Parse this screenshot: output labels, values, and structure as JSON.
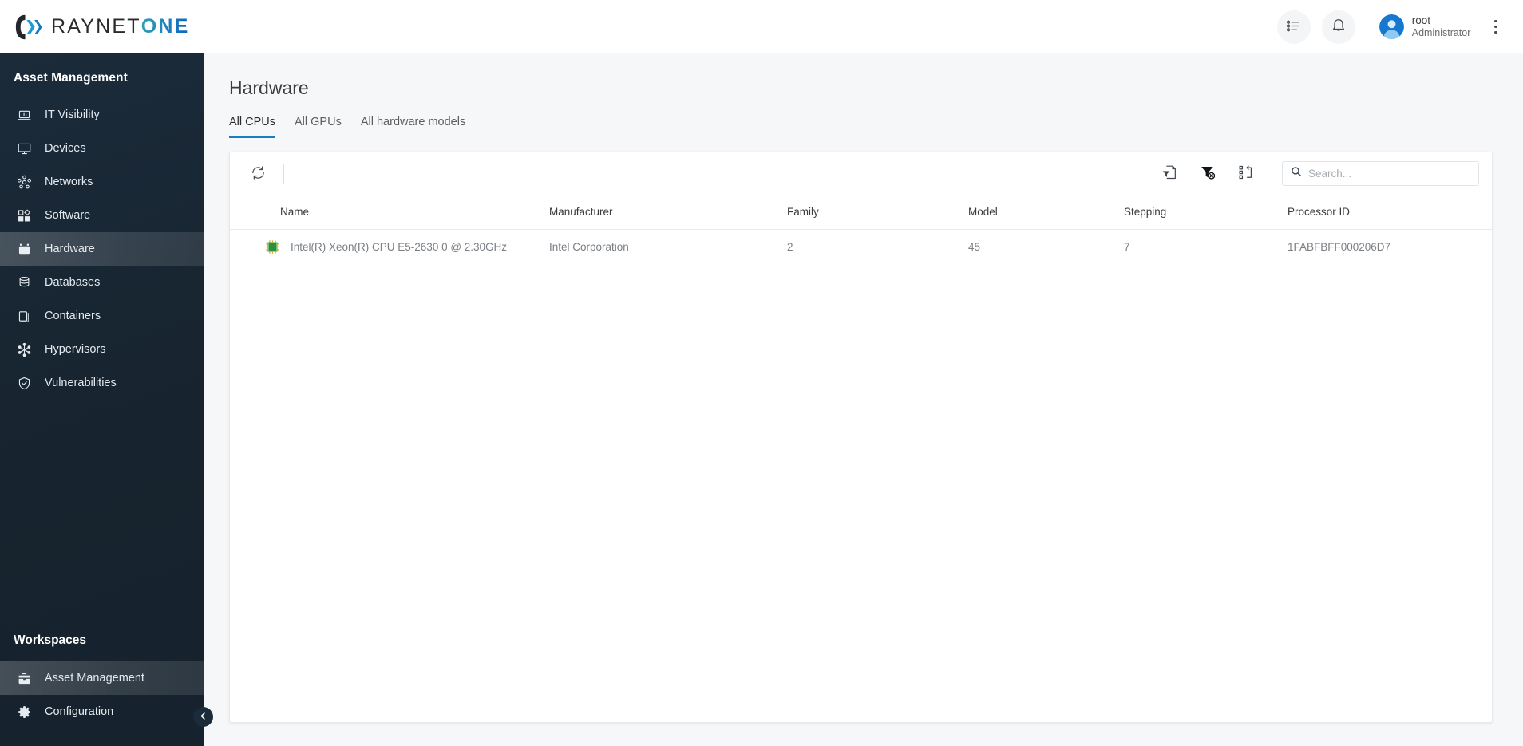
{
  "brand": {
    "name_dark": "RAYNET",
    "name_accent": "ONE",
    "logo_icon": "raynet-logo-mark"
  },
  "topbar": {
    "tasks_icon": "task-list-icon",
    "notifications_icon": "bell-icon",
    "user": {
      "name": "root",
      "role": "Administrator",
      "avatar_icon": "user-avatar-icon"
    },
    "more_icon": "kebab-menu-icon"
  },
  "sidebar": {
    "section_title": "Asset Management",
    "items": [
      {
        "label": "IT Visibility",
        "icon": "laptop-chart-icon",
        "active": false
      },
      {
        "label": "Devices",
        "icon": "monitor-icon",
        "active": false
      },
      {
        "label": "Networks",
        "icon": "network-nodes-icon",
        "active": false
      },
      {
        "label": "Software",
        "icon": "app-blocks-icon",
        "active": false
      },
      {
        "label": "Hardware",
        "icon": "hardware-case-icon",
        "active": true
      },
      {
        "label": "Databases",
        "icon": "database-icon",
        "active": false
      },
      {
        "label": "Containers",
        "icon": "container-box-icon",
        "active": false
      },
      {
        "label": "Hypervisors",
        "icon": "hypervisor-icon",
        "active": false
      },
      {
        "label": "Vulnerabilities",
        "icon": "shield-check-icon",
        "active": false
      }
    ],
    "workspaces_title": "Workspaces",
    "workspaces": [
      {
        "label": "Asset Management",
        "icon": "briefcase-icon",
        "active": true
      },
      {
        "label": "Configuration",
        "icon": "gear-icon",
        "active": false
      }
    ],
    "collapse_icon": "chevron-left-icon"
  },
  "main": {
    "title": "Hardware",
    "tabs": [
      {
        "label": "All CPUs",
        "active": true
      },
      {
        "label": "All GPUs",
        "active": false
      },
      {
        "label": "All hardware models",
        "active": false
      }
    ],
    "toolbar": {
      "refresh_icon": "refresh-icon",
      "save_filter_icon": "filter-document-icon",
      "clear_filter_icon": "filter-clear-icon",
      "columns_icon": "column-settings-icon",
      "search_icon": "search-icon",
      "search_placeholder": "Search...",
      "search_value": ""
    },
    "table": {
      "columns": [
        "Name",
        "Manufacturer",
        "Family",
        "Model",
        "Stepping",
        "Processor ID"
      ],
      "rows": [
        {
          "icon": "cpu-chip-icon",
          "name": "Intel(R) Xeon(R) CPU E5-2630 0 @ 2.30GHz",
          "manufacturer": "Intel Corporation",
          "family": "2",
          "model": "45",
          "stepping": "7",
          "processor_id": "1FABFBFF000206D7"
        }
      ]
    }
  },
  "colors": {
    "accent": "#1a7fc1",
    "sidebar_bg": "#17242f",
    "page_bg": "#f6f7f8",
    "chip_green": "#2f8f3f"
  }
}
